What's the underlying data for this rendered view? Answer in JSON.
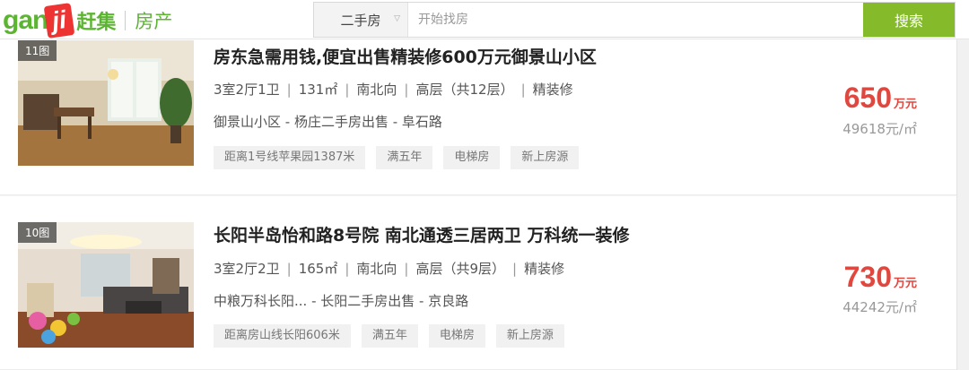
{
  "header": {
    "logo_latin": "gan",
    "logo_ji": "ji",
    "logo_cn": "赶集",
    "logo_sub": "房产",
    "search_category": "二手房",
    "search_placeholder": "开始找房",
    "search_button": "搜索"
  },
  "listings": [
    {
      "pic_count": "11图",
      "title": "房东急需用钱,便宜出售精装修600万元御景山小区",
      "layout": "3室2厅1卫",
      "area": "131㎡",
      "orientation": "南北向",
      "floor": "高层（共12层）",
      "decoration": "精装修",
      "address": "御景山小区 - 杨庄二手房出售 - 阜石路",
      "tags": [
        "距离1号线苹果园1387米",
        "满五年",
        "电梯房",
        "新上房源"
      ],
      "price": "650",
      "price_unit": "万元",
      "unit_price": "49618元/㎡"
    },
    {
      "pic_count": "10图",
      "title": "长阳半岛怡和路8号院 南北通透三居两卫 万科统一装修",
      "layout": "3室2厅2卫",
      "area": "165㎡",
      "orientation": "南北向",
      "floor": "高层（共9层）",
      "decoration": "精装修",
      "address": "中粮万科长阳... - 长阳二手房出售 - 京良路",
      "tags": [
        "距离房山线长阳606米",
        "满五年",
        "电梯房",
        "新上房源"
      ],
      "price": "730",
      "price_unit": "万元",
      "unit_price": "44242元/㎡"
    }
  ],
  "colors": {
    "brand_green": "#5bb531",
    "button_green": "#85bb2b",
    "price_red": "#e0473e"
  }
}
